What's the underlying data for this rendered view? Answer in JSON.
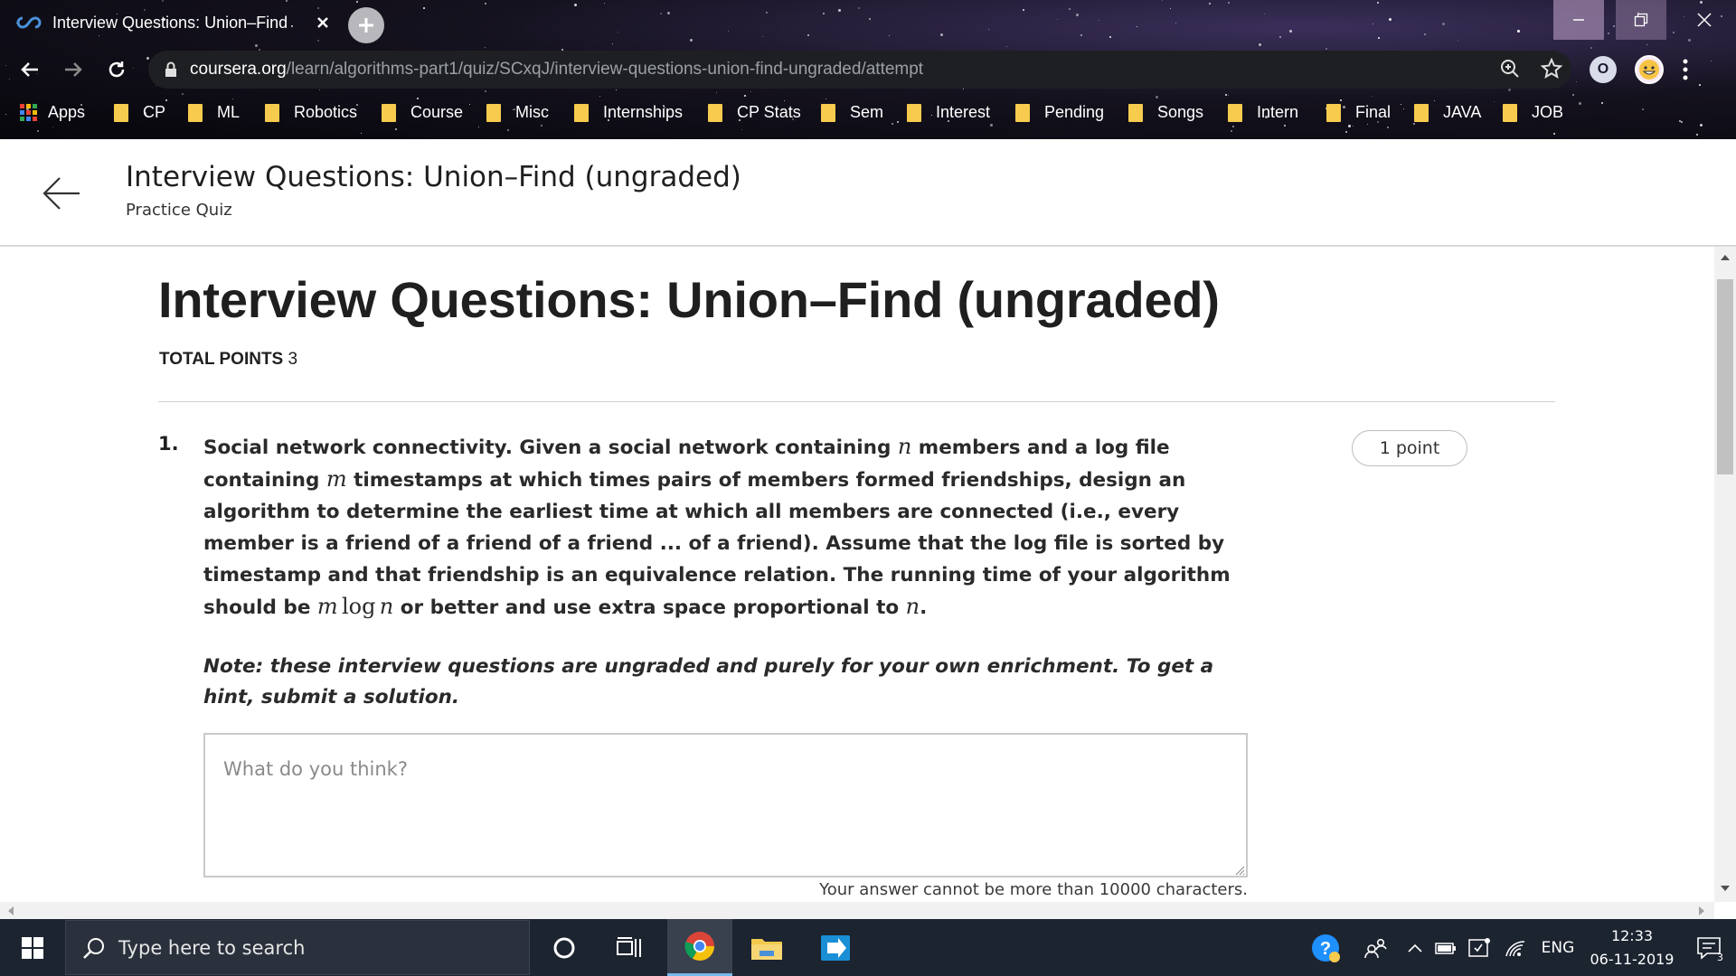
{
  "browser": {
    "tab_title": "Interview Questions: Union–Find",
    "url_host": "coursera.org",
    "url_path": "/learn/algorithms-part1/quiz/SCxqJ/interview-questions-union-find-ungraded/attempt",
    "bookmarks_apps_label": "Apps",
    "bookmarks": [
      "CP",
      "ML",
      "Robotics",
      "Course",
      "Misc",
      "Internships",
      "CP Stats",
      "Sem",
      "Interest",
      "Pending",
      "Songs",
      "Intern",
      "Final",
      "JAVA",
      "JOB"
    ]
  },
  "header": {
    "title": "Interview Questions: Union–Find (ungraded)",
    "subtitle": "Practice Quiz"
  },
  "quiz": {
    "title": "Interview Questions: Union–Find (ungraded)",
    "total_points_label": "TOTAL POINTS",
    "total_points_value": "3"
  },
  "question": {
    "number": "1.",
    "points": "1 point",
    "text_parts": {
      "p1": "Social network connectivity. Given a social network containing ",
      "var_n": "n",
      "p2": " members and a log file containing ",
      "var_m": "m",
      "p3": " timestamps at which times pairs of members formed friendships, design an algorithm to determine the earliest time at which all members are connected (i.e., every member is a friend of a friend of a friend ... of a friend). Assume that the log file is sorted by timestamp and that friendship is an equivalence relation. The running time of your algorithm should be ",
      "complexity_m": "m",
      "complexity_log": "log",
      "complexity_n": "n",
      "p4": " or better and use extra space proportional to ",
      "var_n2": "n",
      "p5": "."
    },
    "note": "Note: these interview questions are ungraded and purely for your own enrichment. To get a hint, submit a solution.",
    "answer_placeholder": "What do you think?",
    "answer_value": "",
    "char_limit": "Your answer cannot be more than 10000 characters."
  },
  "taskbar": {
    "search_placeholder": "Type here to search",
    "language": "ENG",
    "time": "12:33",
    "date": "06-11-2019",
    "notification_count": "3"
  },
  "colors": {
    "folder": "#f7cb4d",
    "taskbar": "#1c2430",
    "accent_blue": "#76b9ed"
  }
}
